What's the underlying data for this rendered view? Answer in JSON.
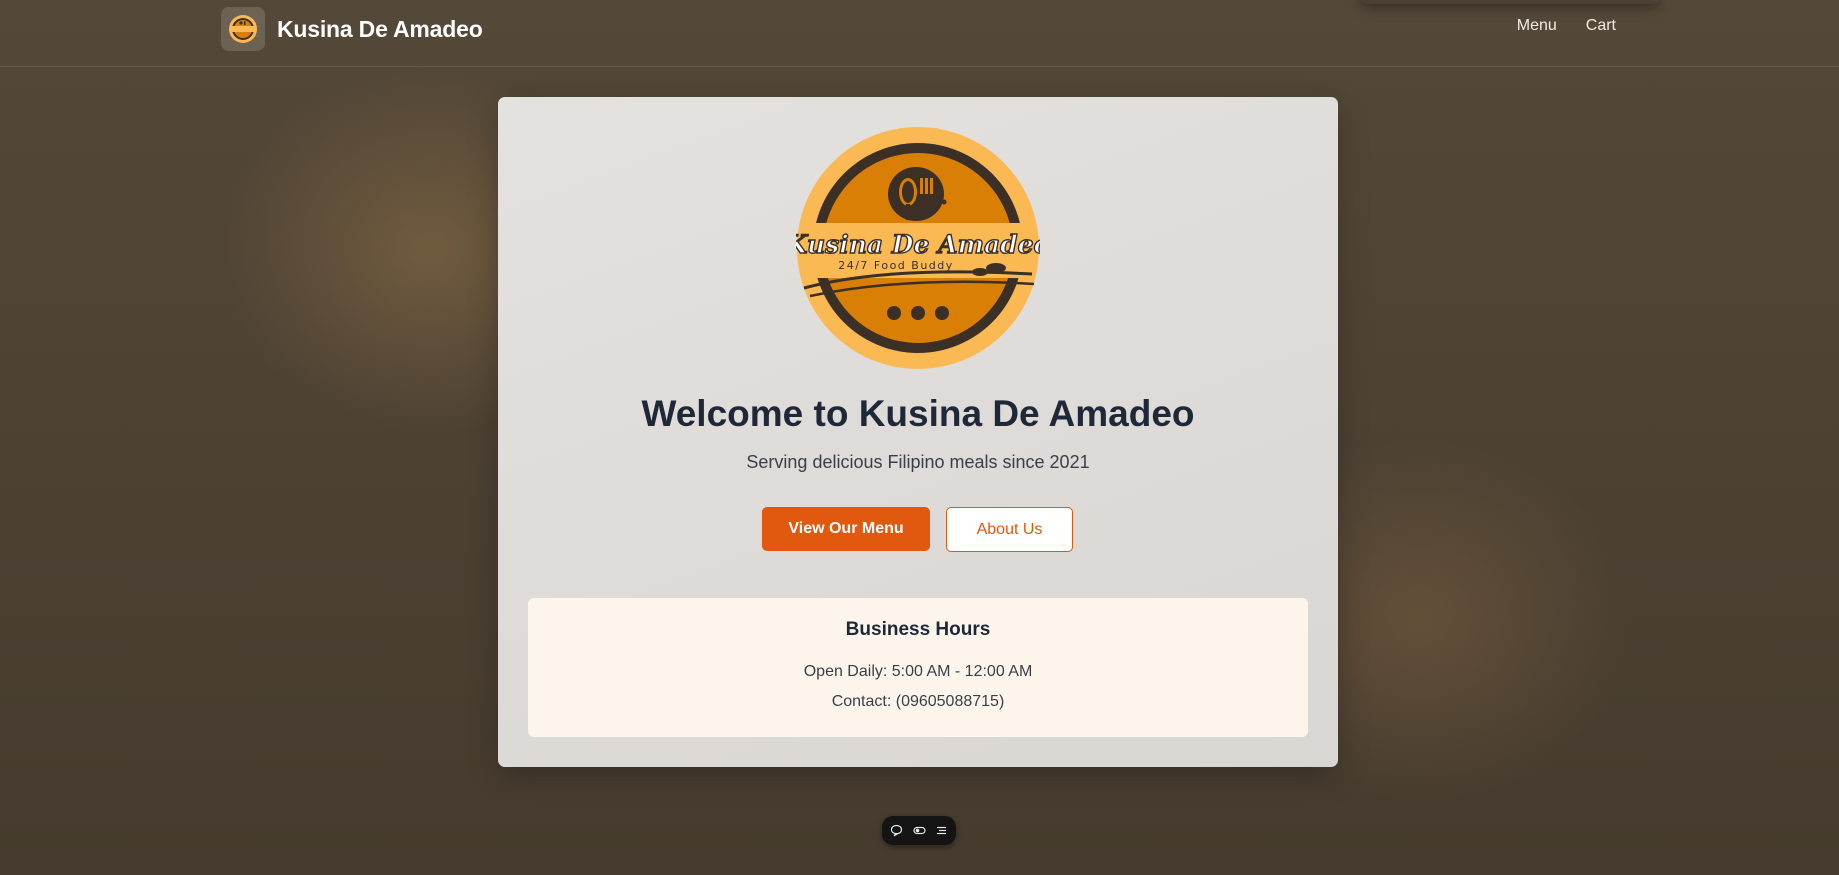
{
  "app": {
    "brand_name": "Kusina De Amadeo"
  },
  "nav": {
    "items": [
      {
        "label": "Menu"
      },
      {
        "label": "Cart"
      }
    ]
  },
  "hero": {
    "logo": {
      "brand_text": "Kusina De Amadeo",
      "tagline": "24/7 Food Buddy"
    },
    "title": "Welcome to Kusina De Amadeo",
    "subtitle": "Serving delicious Filipino meals since 2021",
    "primary_button": "View Our Menu",
    "secondary_button": "About Us"
  },
  "business_hours": {
    "title": "Business Hours",
    "open": "Open Daily: 5:00 AM - 12:00 AM",
    "contact": "Contact: (09605088715)"
  },
  "toolbar": {
    "icons": [
      "comment-icon",
      "toggle-icon",
      "list-icon"
    ]
  },
  "colors": {
    "accent": "#e0590e",
    "logo_outer": "#fbb954",
    "logo_inner": "#d97f05",
    "logo_ring": "#3b2f26",
    "heading": "#1e2838",
    "hours_bg": "#fdf5ec"
  }
}
